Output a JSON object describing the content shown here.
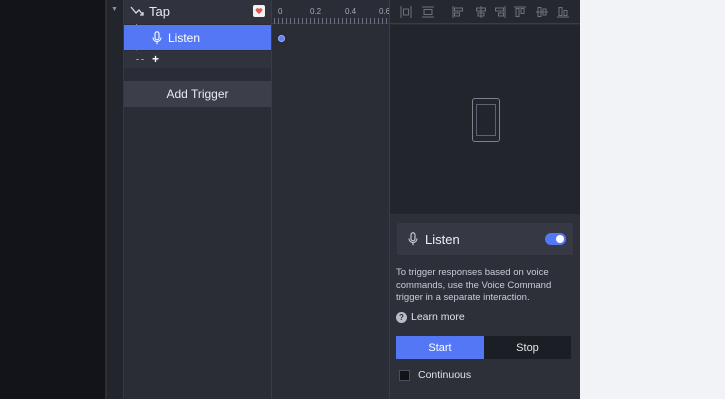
{
  "colors": {
    "accent": "#5478f5",
    "panel_bg": "#2b2d36",
    "canvas_bg": "#131419",
    "page_bg": "#f2f3f7"
  },
  "interactions": {
    "trigger_row": {
      "label": "Tap",
      "icon": "tap-gesture-icon"
    },
    "response_row": {
      "label": "Listen",
      "icon": "microphone-icon"
    },
    "add_response": {
      "label": "+"
    },
    "add_trigger_button": "Add Trigger"
  },
  "timeline": {
    "tick_labels": [
      "0",
      "0.2",
      "0.4",
      "0.6"
    ]
  },
  "align_toolbar": {
    "icons": [
      "distribute-vertical-icon",
      "distribute-horizontal-icon",
      "align-left-icon",
      "align-center-icon",
      "align-right-icon",
      "align-top-icon",
      "align-middle-icon",
      "align-bottom-icon"
    ]
  },
  "properties": {
    "title": "Listen",
    "icon": "microphone-icon",
    "enabled": true,
    "description": "To trigger responses based on voice commands, use the Voice Command trigger in a separate interaction.",
    "learn_more": "Learn more",
    "segmented": {
      "start": "Start",
      "stop": "Stop",
      "selected": "Start"
    },
    "continuous_label": "Continuous",
    "continuous_checked": false
  }
}
